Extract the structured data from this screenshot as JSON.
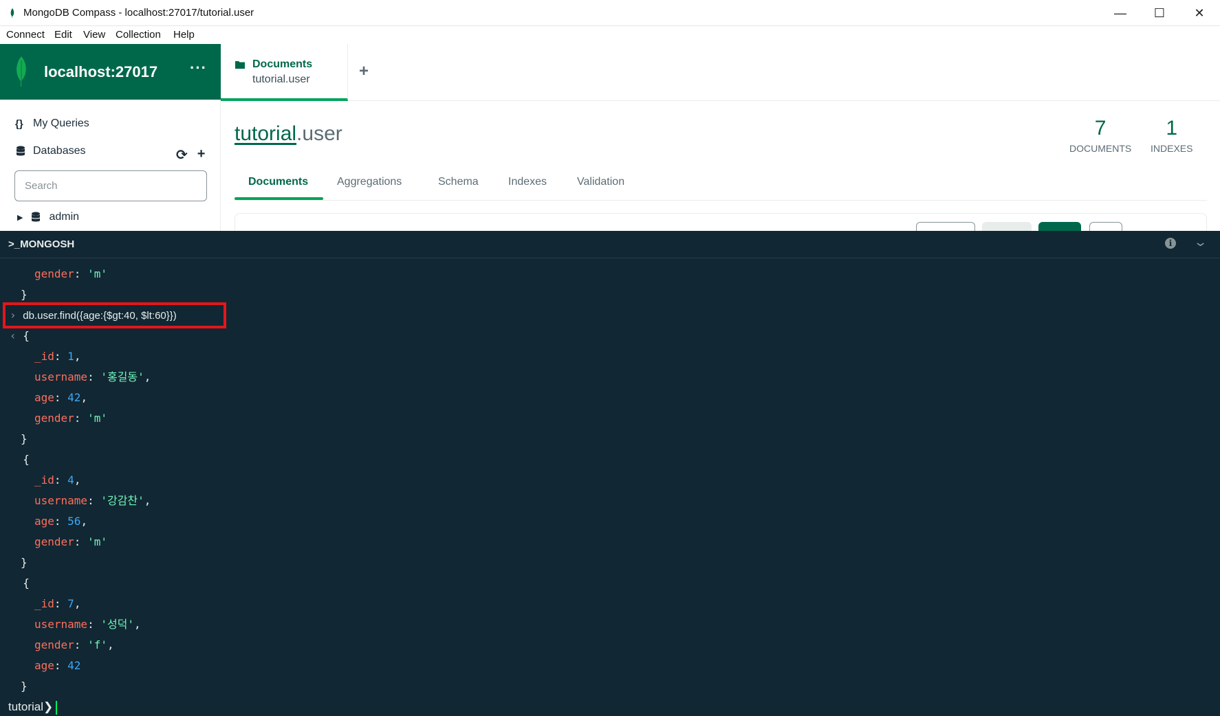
{
  "window": {
    "title": "MongoDB Compass - localhost:27017/tutorial.user",
    "controls": {
      "minimize": "—",
      "maximize": "☐",
      "close": "✕"
    }
  },
  "menu": [
    "Connect",
    "Edit",
    "View",
    "Collection",
    "Help"
  ],
  "sidebar": {
    "host": "localhost:27017",
    "more": "···",
    "my_queries": "My Queries",
    "databases": "Databases",
    "search_placeholder": "Search",
    "databases_list": [
      "admin"
    ]
  },
  "tab": {
    "title": "Documents",
    "subtitle": "tutorial.user",
    "add": "+"
  },
  "collection": {
    "db": "tutorial",
    "name": ".user",
    "documents_count": "7",
    "documents_label": "DOCUMENTS",
    "indexes_count": "1",
    "indexes_label": "INDEXES"
  },
  "subtabs": [
    "Documents",
    "Aggregations",
    "Schema",
    "Indexes",
    "Validation"
  ],
  "shell": {
    "label": ">_MONGOSH",
    "info": "i",
    "prompt": "tutorial",
    "command": "db.user.find({age:{$gt:40, $lt:60}})",
    "prev_doc_tail": {
      "key": "gender",
      "value": "'m'"
    },
    "results": [
      {
        "fields": [
          {
            "key": "_id",
            "value": "1",
            "type": "n",
            "comma": true
          },
          {
            "key": "username",
            "value": "'홍길동'",
            "type": "s",
            "comma": true
          },
          {
            "key": "age",
            "value": "42",
            "type": "n",
            "comma": true
          },
          {
            "key": "gender",
            "value": "'m'",
            "type": "s",
            "comma": false
          }
        ]
      },
      {
        "fields": [
          {
            "key": "_id",
            "value": "4",
            "type": "n",
            "comma": true
          },
          {
            "key": "username",
            "value": "'강감찬'",
            "type": "s",
            "comma": true
          },
          {
            "key": "age",
            "value": "56",
            "type": "n",
            "comma": true
          },
          {
            "key": "gender",
            "value": "'m'",
            "type": "s",
            "comma": false
          }
        ]
      },
      {
        "fields": [
          {
            "key": "_id",
            "value": "7",
            "type": "n",
            "comma": true
          },
          {
            "key": "username",
            "value": "'성덕'",
            "type": "s",
            "comma": true
          },
          {
            "key": "gender",
            "value": "'f'",
            "type": "s",
            "comma": true
          },
          {
            "key": "age",
            "value": "42",
            "type": "n",
            "comma": false
          }
        ]
      }
    ]
  },
  "colors": {
    "brand_green": "#00684a",
    "accent_green": "#00a35c",
    "shell_bg": "#112733",
    "key": "#ff6f5c",
    "string": "#71f6ba",
    "number": "#3ea8f5",
    "highlight": "#e3161b"
  }
}
